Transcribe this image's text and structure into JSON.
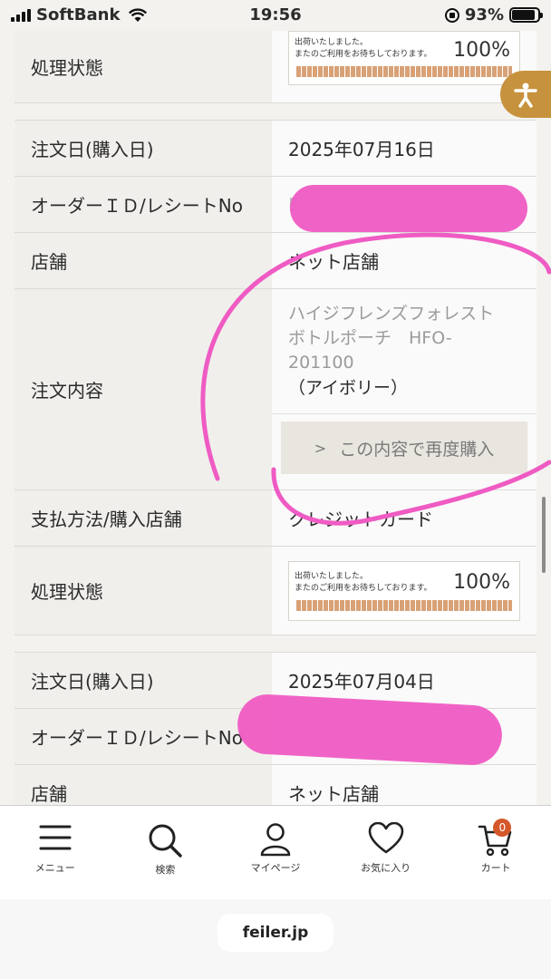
{
  "status_bar": {
    "carrier": "SoftBank",
    "time": "19:56",
    "battery": "93%",
    "battery_level": 0.93
  },
  "orders": [
    {
      "status_label": "処理状態",
      "status_message": "出荷いたしました。\nまたのご利用をお待ちしております。",
      "progress": "100%"
    },
    {
      "date_label": "注文日(購入日)",
      "date": "2025年07月16日",
      "order_id_label": "オーダーＩＤ/レシートNo",
      "order_id": "E",
      "store_label": "店舗",
      "store": "ネット店舗",
      "content_label": "注文内容",
      "product_name": "ハイジフレンズフォレスト　ボトルポーチ　HFO-201100",
      "product_color": "（アイボリー）",
      "reorder_label": "この内容で再度購入",
      "payment_label": "支払方法/購入店舗",
      "payment": "クレジットカード",
      "status_label": "処理状態",
      "status_message": "出荷いたしました。\nまたのご利用をお待ちしております。",
      "progress": "100%"
    },
    {
      "date_label": "注文日(購入日)",
      "date": "2025年07月04日",
      "order_id_label": "オーダーＩＤ/レシートNo",
      "store_label": "店舗",
      "store": "ネット店舗"
    }
  ],
  "nav": [
    {
      "label": "メニュー",
      "icon": "menu-icon"
    },
    {
      "label": "検索",
      "icon": "search-icon"
    },
    {
      "label": "マイページ",
      "icon": "user-icon"
    },
    {
      "label": "お気に入り",
      "icon": "heart-icon"
    },
    {
      "label": "カート",
      "icon": "cart-icon",
      "badge": "0"
    }
  ],
  "url": "feiler.jp",
  "colors": {
    "accent": "#c7923d",
    "redaction": "#ef5bc3",
    "badge": "#d4572a"
  }
}
